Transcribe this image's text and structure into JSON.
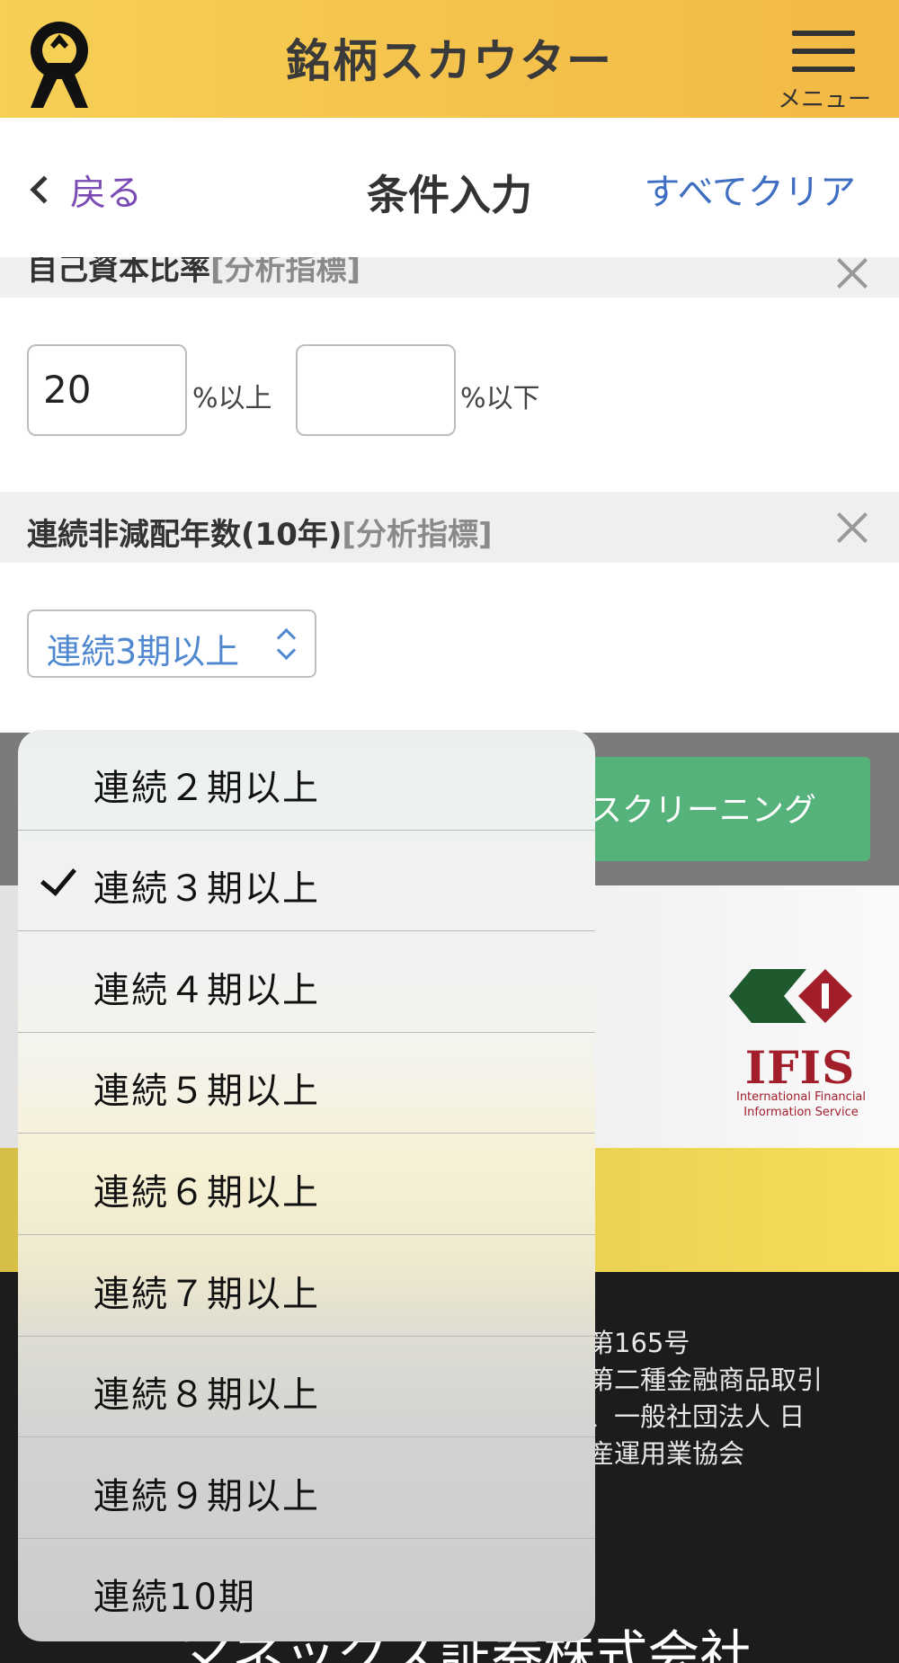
{
  "header": {
    "title": "銘柄スカウター",
    "menu_label": "メニュー"
  },
  "nav": {
    "back_label": "戻る",
    "title": "条件入力",
    "clear_all_label": "すべてクリア"
  },
  "equity_ratio": {
    "title": "自己資本比率",
    "tag": "[分析指標]",
    "min_value": "20",
    "min_unit": "%以上",
    "max_value": "",
    "max_unit": "%以下"
  },
  "dividend_years": {
    "title": "連続非減配年数(10年)",
    "tag": "[分析指標]",
    "selected": "連続3期以上"
  },
  "screening_button_label": "スクリーニング",
  "ifis": {
    "name": "IFIS",
    "sub_line1": "International Financial",
    "sub_line2": "Information Service"
  },
  "footer": {
    "line1": "第165号",
    "line2": "第二種金融商品取引",
    "line3": "、一般社団法人 日",
    "line4": "産運用業協会",
    "company": "マネックス証券株式会社"
  },
  "picker": {
    "options": [
      "連続２期以上",
      "連続３期以上",
      "連続４期以上",
      "連続５期以上",
      "連続６期以上",
      "連続７期以上",
      "連続８期以上",
      "連続９期以上",
      "連続10期"
    ],
    "selected_index": 1
  },
  "colors": {
    "header_yellow": "#f6cf55",
    "link_purple": "#7a4bb5",
    "link_blue": "#3f6fc3",
    "select_blue": "#4f87d1",
    "screening_green": "#55b27a",
    "ifis_red": "#a21e2b"
  }
}
